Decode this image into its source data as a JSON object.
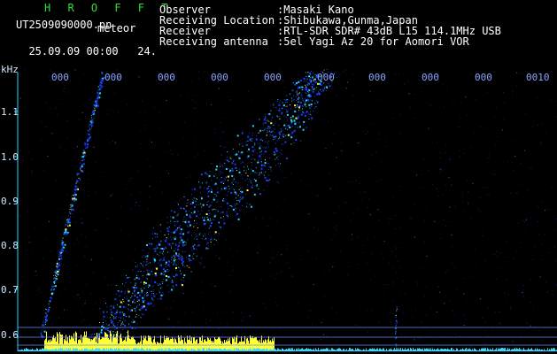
{
  "header": {
    "app_title": "H R O F F T",
    "filename": "UT2509090000.pn",
    "tag": "meteor",
    "date": "25.09.09 00:00",
    "value": "24.",
    "fields": [
      {
        "label": "Observer",
        "value": ":Masaki Kano"
      },
      {
        "label": "Receiving Location",
        "value": ":Shibukawa,Gunma,Japan"
      },
      {
        "label": "Receiver",
        "value": ":RTL-SDR SDR# 43dB L15 114.1MHz USB"
      },
      {
        "label": "Receiving antenna",
        "value": ":5el Yagi Az 20 for Aomori VOR"
      }
    ]
  },
  "chart_data": {
    "type": "heatmap",
    "y_unit": "kHz",
    "y_ticks": [
      "1.1",
      "1.0",
      "0.9",
      "0.8",
      "0.7",
      "0.6"
    ],
    "x_ticks": [
      "000",
      "000",
      "000",
      "000",
      "000",
      "000",
      "000",
      "000",
      "000",
      "0010"
    ],
    "colors": {
      "background": "#000000",
      "signal_low": "#1a3cff",
      "signal_mid": "#2ad4ff",
      "signal_high": "#ffff33",
      "grid": "#6a8cff",
      "baseline": "#33ddff"
    }
  }
}
